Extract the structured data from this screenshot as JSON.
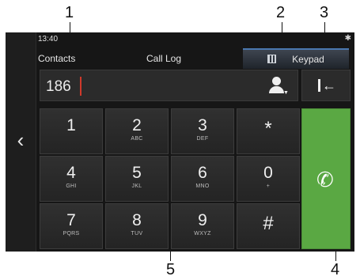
{
  "status": {
    "time": "13:40",
    "bluetooth_icon": "bluetooth-icon"
  },
  "tabs": [
    {
      "label": "Contacts"
    },
    {
      "label": "Call Log"
    },
    {
      "label": "Keypad",
      "active": true,
      "icon": "keypad-icon"
    }
  ],
  "entry": {
    "value": "186"
  },
  "keys": [
    {
      "digit": "1",
      "letters": ""
    },
    {
      "digit": "2",
      "letters": "ABC"
    },
    {
      "digit": "3",
      "letters": "DEF"
    },
    {
      "digit": "*",
      "letters": ""
    },
    {
      "digit": "4",
      "letters": "GHI"
    },
    {
      "digit": "5",
      "letters": "JKL"
    },
    {
      "digit": "6",
      "letters": "MNO"
    },
    {
      "digit": "0",
      "letters": "+"
    },
    {
      "digit": "7",
      "letters": "PQRS"
    },
    {
      "digit": "8",
      "letters": "TUV"
    },
    {
      "digit": "9",
      "letters": "WXYZ"
    },
    {
      "digit": "#",
      "letters": ""
    }
  ],
  "callouts": [
    "1",
    "2",
    "3",
    "4",
    "5"
  ],
  "colors": {
    "call_green": "#5aa843",
    "cursor_red": "#d0392b",
    "tab_accent": "#4a78b0"
  }
}
